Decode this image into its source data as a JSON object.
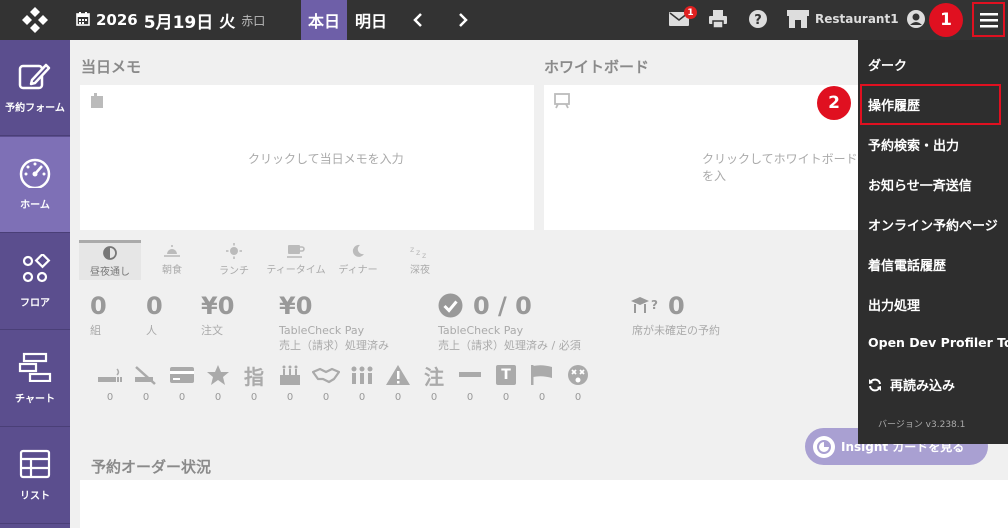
{
  "header": {
    "year": "2026",
    "month_day": "5月19日",
    "weekday": "火",
    "rokuyo": "赤口",
    "today_label": "本日",
    "tomorrow_label": "明日",
    "mail_badge": "1",
    "store_name": "Restaurant1",
    "icons": [
      "logo-icon",
      "calendar-icon",
      "chevron-left-icon",
      "chevron-right-icon",
      "mail-icon",
      "print-icon",
      "help-icon",
      "store-icon",
      "user-icon",
      "hamburger-menu-icon"
    ]
  },
  "callouts": {
    "one": "1",
    "two": "2",
    "color": "#e01020"
  },
  "sidebar": {
    "items": [
      {
        "label": "予約フォーム",
        "icon": "edit-icon"
      },
      {
        "label": "ホーム",
        "icon": "gauge-icon"
      },
      {
        "label": "フロア",
        "icon": "floor-icon"
      },
      {
        "label": "チャート",
        "icon": "chart-icon"
      },
      {
        "label": "リスト",
        "icon": "table-icon"
      }
    ],
    "bg": "#5b4e8e",
    "active_bg": "#7e70b6"
  },
  "memo": {
    "title": "当日メモ",
    "placeholder": "クリックして当日メモを入力"
  },
  "whiteboard": {
    "title": "ホワイトボード",
    "placeholder": "クリックしてホワイトボードを入"
  },
  "tabs": [
    {
      "label": "昼夜通し"
    },
    {
      "label": "朝食"
    },
    {
      "label": "ランチ"
    },
    {
      "label": "ティータイム"
    },
    {
      "label": "ディナー"
    },
    {
      "label": "深夜"
    }
  ],
  "stats": {
    "groups": {
      "value": "0",
      "label": "組"
    },
    "people": {
      "value": "0",
      "label": "人"
    },
    "orders": {
      "value": "¥0",
      "label": "注文"
    },
    "tc_pay": {
      "value": "¥0",
      "line1": "TableCheck Pay",
      "line2": "売上（請求）処理済み"
    },
    "tc_pay_required": {
      "value": "0 / 0",
      "line1": "TableCheck Pay",
      "line2": "売上（請求）処理済み / 必須"
    },
    "unassigned": {
      "value": "0",
      "label": "席が未確定の予約"
    }
  },
  "mini_icons": [
    {
      "icon": "smoking-icon",
      "count": "0"
    },
    {
      "icon": "no-smoking-icon",
      "count": "0"
    },
    {
      "icon": "card-icon",
      "count": "0"
    },
    {
      "icon": "star-icon",
      "count": "0"
    },
    {
      "icon": "designated-icon",
      "text": "指",
      "count": "0"
    },
    {
      "icon": "birthday-cake-icon",
      "count": "0"
    },
    {
      "icon": "handshake-icon",
      "count": "0"
    },
    {
      "icon": "group-icon",
      "count": "0"
    },
    {
      "icon": "warning-icon",
      "count": "0"
    },
    {
      "icon": "note-icon",
      "text": "注",
      "count": "0"
    },
    {
      "icon": "minus-icon",
      "count": "0"
    },
    {
      "icon": "t-box-icon",
      "text": "T",
      "count": "0"
    },
    {
      "icon": "flag-icon",
      "count": "0"
    },
    {
      "icon": "dizzy-face-icon",
      "count": "0"
    }
  ],
  "order_status": {
    "title": "予約オーダー状況"
  },
  "insight": {
    "label": "Insightカードを見る",
    "visible_label": "Insight カードを見る"
  },
  "menu": {
    "items": [
      "ダーク",
      "操作履歴",
      "予約検索・出力",
      "お知らせ一斉送信",
      "オンライン予約ページ",
      "着信電話履歴",
      "出力処理",
      "Open Dev Profiler Tool",
      "再読み込み"
    ],
    "version": "バージョン v3.238.1"
  }
}
